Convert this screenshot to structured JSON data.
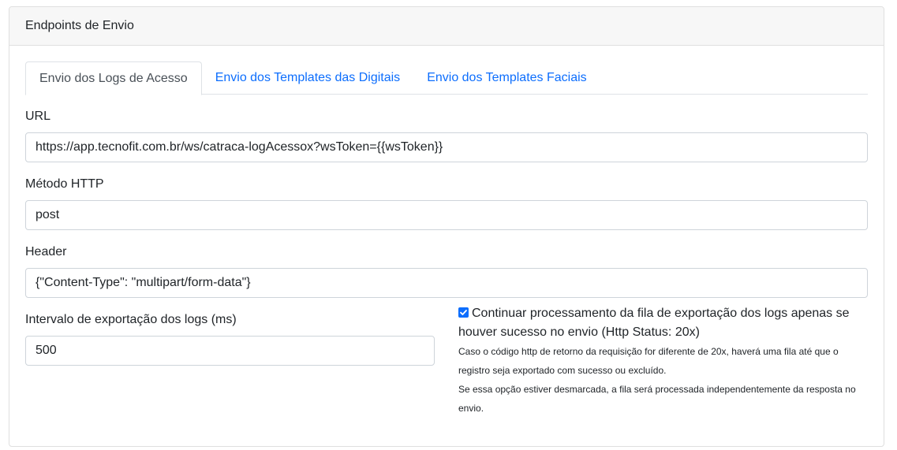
{
  "card": {
    "title": "Endpoints de Envio"
  },
  "tabs": [
    {
      "label": "Envio dos Logs de Acesso",
      "active": true
    },
    {
      "label": "Envio dos Templates das Digitais",
      "active": false
    },
    {
      "label": "Envio dos Templates Faciais",
      "active": false
    }
  ],
  "form": {
    "url": {
      "label": "URL",
      "value": "https://app.tecnofit.com.br/ws/catraca-logAcessox?wsToken={{wsToken}}"
    },
    "method": {
      "label": "Método HTTP",
      "value": "post"
    },
    "header": {
      "label": "Header",
      "value": "{\"Content-Type\": \"multipart/form-data\"}"
    },
    "interval": {
      "label": "Intervalo de exportação dos logs (ms)",
      "value": "500"
    },
    "continue_option": {
      "checked": true,
      "label": "Continuar processamento da fila de exportação dos logs apenas se houver sucesso no envio (Http Status: 20x)",
      "help_1": "Caso o código http de retorno da requisição for diferente de 20x, haverá uma fila até que o registro seja exportado com sucesso ou excluído.",
      "help_2": "Se essa opção estiver desmarcada, a fila será processada independentemente da resposta no envio."
    }
  },
  "colors": {
    "link": "#0d6efd",
    "checkbox": "#0d6efd",
    "header_bg": "#f7f7f7"
  },
  "icons": {
    "checkbox": "check-icon"
  }
}
